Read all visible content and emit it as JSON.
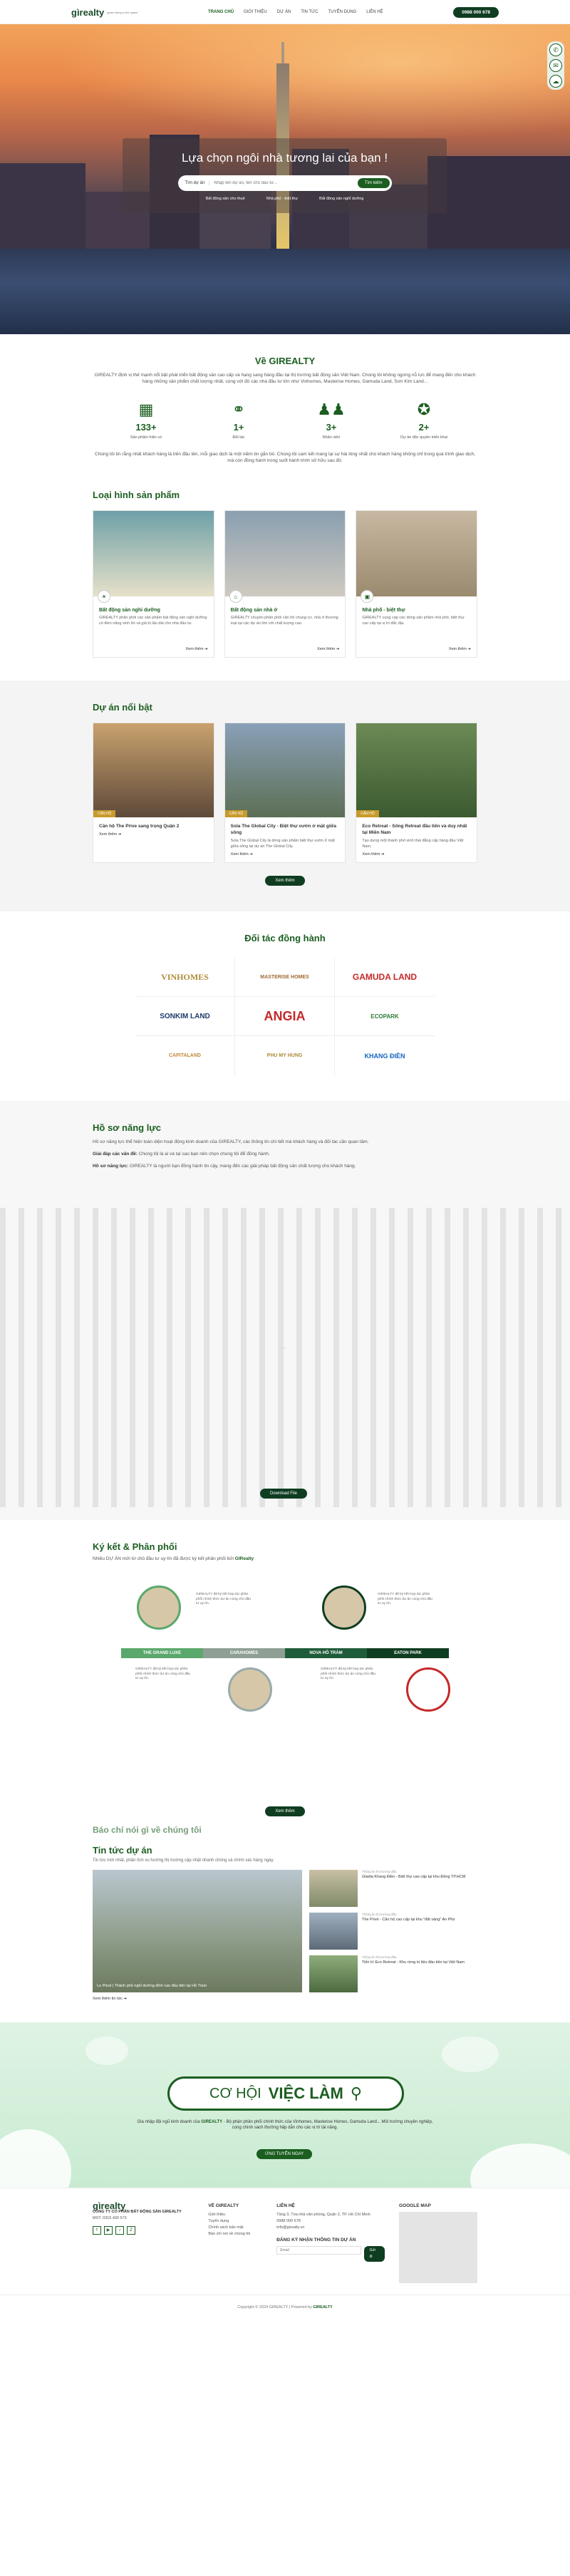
{
  "header": {
    "logo": "gìrealty",
    "logo_sub": "green living in the space",
    "nav": [
      "TRANG CHỦ",
      "GIỚI THIỆU",
      "DỰ ÁN",
      "TIN TỨC",
      "TUYỂN DỤNG",
      "LIÊN HỆ"
    ],
    "hotline": "0988 000 678"
  },
  "floaters": [
    "phone-icon",
    "chat-icon",
    "messenger-icon"
  ],
  "hero": {
    "title": "Lựa chọn ngôi nhà tương lai của bạn !",
    "select": "Tìm dự án",
    "placeholder": "Nhập tên dự án, tên chủ đầu tư...",
    "button": "Tìm kiếm",
    "filters": [
      "Bất động sản cho thuê",
      "Nhà phố - biệt thự",
      "Bất động sản nghỉ dưỡng"
    ]
  },
  "about": {
    "title": "Về GIREALTY",
    "text1": "GIREALTY định vị thế mạnh nổi bật phát triển bất động sản cao cấp và hạng sang hàng đầu tại thị trường bất động sản Việt Nam. Chúng tôi không ngừng nỗ lực để mang đến cho khách hàng những sản phẩm chất lượng nhất, cùng với đó các nhà đầu tư lớn như Vinhomes, Masterise Homes, Gamuda Land, Sơn Kim Land...",
    "text2": "Chúng tôi tin rằng nhất khách hàng là trên đầu tên, mỗi giao dịch là một niềm tin gắn bó. Chúng tôi cam kết mang lại sự hài lòng nhất cho khách hàng không chỉ trong quá trình giao dịch, mà còn đồng hành trong suốt hành trình sở hữu sau đó.",
    "stats": [
      {
        "icon": "building-icon",
        "num": "133+",
        "label": "Sản phẩm hiện có"
      },
      {
        "icon": "deal-icon",
        "num": "1+",
        "label": "Đối tác"
      },
      {
        "icon": "team-icon",
        "num": "3+",
        "label": "Nhân viên"
      },
      {
        "icon": "award-icon",
        "num": "2+",
        "label": "Dự án độc quyền triển khai"
      }
    ]
  },
  "products": {
    "title": "Loại hình sản phẩm",
    "more": "Xem thêm ➔",
    "items": [
      {
        "title": "Bất động sản nghỉ dưỡng",
        "desc": "GIREALTY phân phối các sản phẩm bất động sản nghỉ dưỡng có tiềm năng sinh lời và giá trị lâu dài cho nhà đầu tư.",
        "colors": [
          "#6ea0a8",
          "#e6e1c9"
        ]
      },
      {
        "title": "Bất động sản nhà ở",
        "desc": "GIREALTY chuyên phân phối căn hộ chung cư, nhà ở thương mại tại các dự án lớn với chất lượng cao.",
        "colors": [
          "#8a9fb0",
          "#cfcac0"
        ]
      },
      {
        "title": "Nhà phố - biệt thự",
        "desc": "GIREALTY cung cấp các dòng sản phẩm nhà phố, biệt thự cao cấp tại vị trí đắc địa.",
        "colors": [
          "#c8b8a2",
          "#9a8a6e"
        ]
      }
    ]
  },
  "projects": {
    "title": "Dự án nổi bật",
    "more": "Xem thêm ➔",
    "button": "Xem thêm",
    "items": [
      {
        "tag": "CĂN HỘ",
        "title": "Căn hộ The Prive sang trọng Quận 2",
        "desc": "",
        "colors": [
          "#c9a16e",
          "#5e4a3a"
        ]
      },
      {
        "tag": "CĂN HỘ",
        "title": "Sola The Global City - Biệt thự vườn ở mặt giữa sông",
        "desc": "Sola The Global City là dòng sản phẩm biệt thự vườn ở mặt giữa sông tại dự án The Global City.",
        "colors": [
          "#8aa0b8",
          "#5c6f55"
        ]
      },
      {
        "tag": "CĂN HỘ",
        "title": "Eco Retreat - Sống Retreat đầu tiên và duy nhất tại Miền Nam",
        "desc": "Tạo dựng một thành phố sinh thái đẳng cấp hàng đầu Việt Nam.",
        "colors": [
          "#6c8a55",
          "#3b5a30"
        ]
      }
    ]
  },
  "partners": {
    "title": "Đối tác đồng hành",
    "items": [
      {
        "name": "VINHOMES",
        "color": "#b08b3a"
      },
      {
        "name": "MASTERISE HOMES",
        "color": "#a06a32"
      },
      {
        "name": "GAMUDA LAND",
        "color": "#c62828"
      },
      {
        "name": "SONKIM LAND",
        "color": "#1b3a6b"
      },
      {
        "name": "ANGIA",
        "color": "#c62828"
      },
      {
        "name": "ECOPARK",
        "color": "#2e7d32"
      },
      {
        "name": "CAPITALAND",
        "color": "#c08a3a"
      },
      {
        "name": "PHU MY HUNG",
        "color": "#b08b3a"
      },
      {
        "name": "KHANG ĐIỀN",
        "color": "#1565c0"
      }
    ]
  },
  "profile": {
    "title": "Hồ sơ năng lực",
    "p1": "Hồ sơ năng lực thể hiện toàn diện hoạt động kinh doanh của GIREALTY, các thông tin chi tiết mà khách hàng và đối tác cần quan tâm.",
    "p2_b": "Giải đáp các vấn đề:",
    "p2": "Chúng tôi là ai và tại sao bạn nên chọn chúng tôi để đồng hành.",
    "p3_b": "Hồ sơ năng lực:",
    "p3": "GIREALTY là người bạn đồng hành tin cậy, mang đến các giải pháp bất động sản chất lượng cho khách hàng.",
    "placeholder": "...",
    "button": "Download File"
  },
  "dist": {
    "title": "Ký kết & Phân phối",
    "sub_pre": "Nhiều DỰ ÁN mới từ chủ đầu tư uy tín đã được ký kết phân phối bởi",
    "sub_b": "GIRealty",
    "segments": [
      {
        "label": "THE GRAND LUXE",
        "color": "#5aa86b"
      },
      {
        "label": "CARAHOMES",
        "color": "#8f9f95"
      },
      {
        "label": "NOVA HỒ TRÀM",
        "color": "#1f5c3a"
      },
      {
        "label": "EATON PARK",
        "color": "#0f3d21"
      }
    ],
    "notes": [
      "GIREALTY đã ký kết hợp tác phân phối chính thức dự án cùng chủ đầu tư uy tín.",
      "GIREALTY đã ký kết hợp tác phân phối chính thức dự án cùng chủ đầu tư uy tín.",
      "GIREALTY đã ký kết hợp tác phân phối chính thức dự án cùng chủ đầu tư uy tín.",
      "GIREALTY đã ký kết hợp tác phân phối chính thức dự án cùng chủ đầu tư uy tín."
    ],
    "button": "Xem thêm"
  },
  "news": {
    "partial": "Báo chí nói gì về chúng tôi",
    "title": "Tin tức dự án",
    "sub": "Tin tức mới nhất, phân tích xu hướng thị trường cập nhật nhanh chóng và chính xác hàng ngày.",
    "main_cap": "Le Pinot | Thành phố nghỉ dưỡng đỉnh cao đầu tiên tại Hồ Tràm",
    "more": "Xem thêm tin tức ➔",
    "items": [
      {
        "date": "Thông tin thị trường đầu",
        "title": "Gladia Khang Điền - Biệt thự cao cấp tại khu Đông TP.HCM"
      },
      {
        "date": "Thông tin thị trường đầu",
        "title": "The Privé - Căn hộ cao cấp tại khu \"đất vàng\" An Phú"
      },
      {
        "date": "Thông tin thị trường đầu",
        "title": "Tiến trì Eco Retreat - Khu rừng trị liệu đầu tiên tại Việt Nam"
      }
    ]
  },
  "careers": {
    "t1": "CƠ HỘI",
    "t2": "VIỆC LÀM",
    "text_pre": "Gia nhập đội ngũ kinh doanh của",
    "text_b": "GIREALTY",
    "text": "- Bộ phận phân phối chính thức của Vinhomes, Masterise Homes, Gamuda Land... Môi trường chuyên nghiệp, cùng chính sách thưởng hấp dẫn cho các vị trí tài năng.",
    "button": "ỨNG TUYỂN NGAY"
  },
  "footer": {
    "company": "CÔNG TY CỔ PHẦN BẤT ĐỘNG SẢN GIREALTY",
    "mst": "MST: 0316 430 573",
    "col2_title": "VỀ GIREALTY",
    "col2": [
      "Giới thiệu",
      "Tuyển dụng",
      "Chính sách bảo mật",
      "Báo chí nói về chúng tôi"
    ],
    "col3_title": "LIÊN HỆ",
    "col3": [
      "Tầng 3, Tòa nhà văn phòng, Quận 2, TP. Hồ Chí Minh",
      "0988 000 678",
      "info@girealty.vn"
    ],
    "col4_title": "GOOGLE MAP",
    "sub_title": "ĐĂNG KÝ NHẬN THÔNG TIN DỰ ÁN",
    "sub_placeholder": "Email",
    "sub_button": "Gửi đi",
    "copyright_pre": "Copyright © 2024 GIREALTY | Powered by",
    "copyright_b": "GIREALTY"
  }
}
